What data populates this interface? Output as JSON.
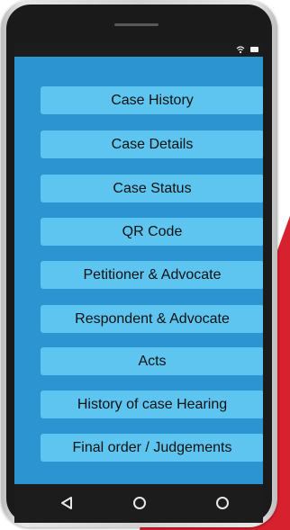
{
  "menu": {
    "items": [
      {
        "label": "Case History"
      },
      {
        "label": "Case Details"
      },
      {
        "label": "Case Status"
      },
      {
        "label": "QR Code"
      },
      {
        "label": "Petitioner & Advocate"
      },
      {
        "label": "Respondent & Advocate"
      },
      {
        "label": "Acts"
      },
      {
        "label": "History of case Hearing"
      },
      {
        "label": "Final order / Judgements"
      }
    ]
  },
  "status_bar": {
    "icons": [
      "wifi-icon",
      "battery-icon"
    ]
  },
  "nav_bar": {
    "icons": [
      "back-icon",
      "home-icon",
      "recent-apps-icon"
    ]
  },
  "colors": {
    "screen_background": "#2d94d2",
    "menu_button": "#5ec5f1",
    "accent_red": "#d7212f",
    "phone_body": "#1a1a1a"
  }
}
